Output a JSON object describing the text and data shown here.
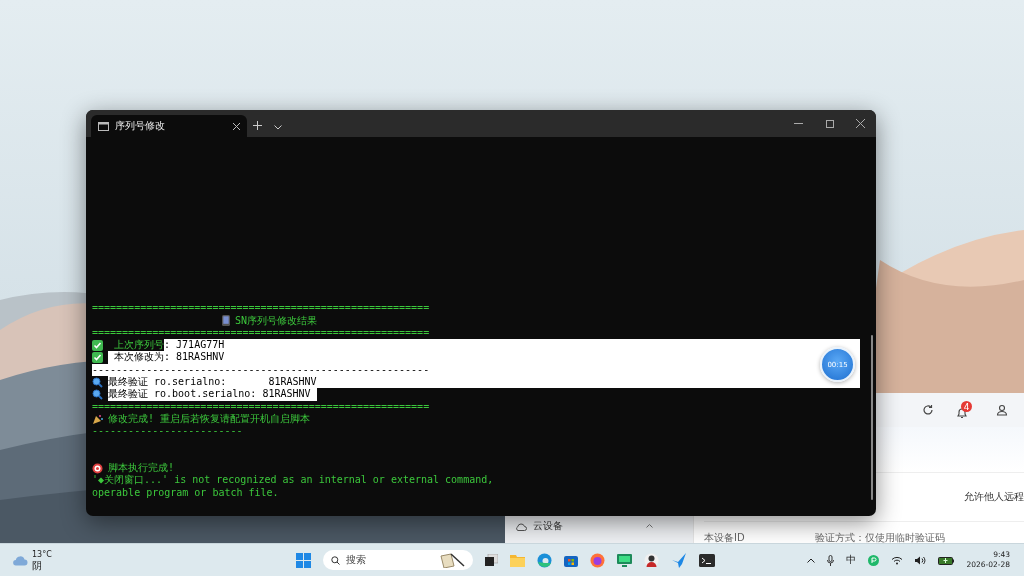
{
  "terminal": {
    "tab_title": "序列号修改",
    "lines": [
      {
        "kind": "rule",
        "parts": [
          {
            "text": "========================================================",
            "selected": false
          }
        ],
        "selected_to_end": false
      },
      {
        "kind": "title",
        "parts": [
          {
            "text": "SN序列号修改结果",
            "selected": false
          }
        ],
        "selected_to_end": false
      },
      {
        "kind": "rule",
        "parts": [
          {
            "text": "========================================================",
            "selected": false
          }
        ],
        "selected_to_end": false
      },
      {
        "kind": "success",
        "parts": [
          {
            "text": " 上次序列号",
            "selected": false
          },
          {
            "text": ": J71AG77H",
            "selected": true
          }
        ],
        "selected_to_end": true
      },
      {
        "kind": "success",
        "parts": [
          {
            "text": " 本次修改为: 81RASHNV",
            "selected": true
          }
        ],
        "selected_to_end": true
      },
      {
        "kind": "rule",
        "parts": [
          {
            "text": "--------------------------------------------------------",
            "selected": true
          }
        ],
        "selected_to_end": true
      },
      {
        "kind": "verify",
        "parts": [
          {
            "text": "最终验证 ro.serialno:       81RASHNV",
            "selected": true
          }
        ],
        "selected_to_end": true
      },
      {
        "kind": "verify",
        "parts": [
          {
            "text": "最终验证 ro.boot.serialno: 81RASHNV ",
            "selected": true
          }
        ],
        "selected_to_end": false
      },
      {
        "kind": "rule",
        "parts": [
          {
            "text": "========================================================",
            "selected": false
          }
        ],
        "selected_to_end": false
      },
      {
        "kind": "done",
        "parts": [
          {
            "text": "修改完成! 重启后若恢复请配置开机自启脚本",
            "selected": false
          }
        ],
        "selected_to_end": false
      },
      {
        "kind": "rule",
        "parts": [
          {
            "text": "-------------------------",
            "selected": false
          }
        ],
        "selected_to_end": false
      },
      {
        "kind": "blank",
        "selected_to_end": false
      },
      {
        "kind": "finish",
        "parts": [
          {
            "text": "脚本执行完成!",
            "selected": false
          }
        ],
        "selected_to_end": false
      },
      {
        "kind": "plain",
        "parts": [
          {
            "text": "'◆关闭窗口...' is not recognized as an internal or external command,",
            "selected": false
          }
        ],
        "selected_to_end": false
      },
      {
        "kind": "plain",
        "parts": [
          {
            "text": "operable program or batch file.",
            "selected": false
          }
        ],
        "selected_to_end": false
      }
    ]
  },
  "timer": "00:15",
  "background_app": {
    "notification_count": "4",
    "side_item": "云设备",
    "option_label": "允许他人远程",
    "device_id_label": "本设备ID",
    "verify_label": "验证方式：仅使用临时验证码"
  },
  "taskbar": {
    "weather": {
      "temperature": "13°C",
      "condition": "阴"
    },
    "search_placeholder": "搜索",
    "ime": "中",
    "time": "9:43",
    "date": "2026-02-28"
  }
}
